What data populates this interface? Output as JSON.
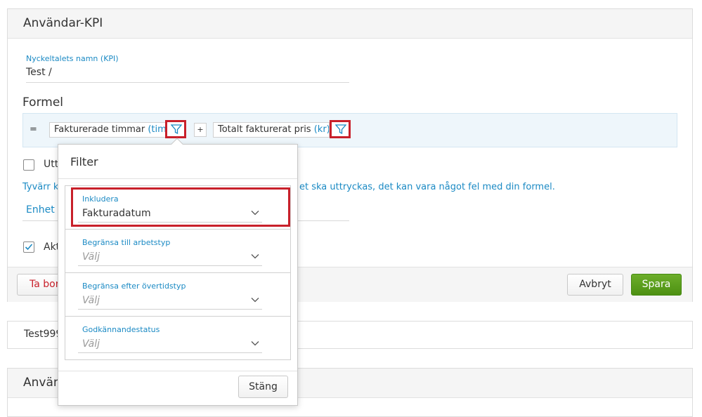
{
  "kpi_card": {
    "title": "Användar-KPI",
    "name_field": {
      "label": "Nyckeltalets namn (KPI)",
      "value": "Test /"
    },
    "formula": {
      "heading": "Formel",
      "equals": "=",
      "term1": {
        "name": "Fakturerade timmar",
        "unit": "(tim"
      },
      "operator": "+",
      "term2": {
        "name": "Totalt fakturerat pris",
        "unit": "(kr)"
      }
    },
    "checkbox1_label": "Utt",
    "error_left": "Tyvärr k",
    "error_right": "et ska uttryckas, det kan vara något fel med din formel.",
    "unit_label": "Enhet",
    "active_checkbox_label": "Akt",
    "delete_button": "Ta bor",
    "cancel_button": "Avbryt",
    "save_button": "Spara"
  },
  "list_item": {
    "text": "Test999"
  },
  "second_card": {
    "title": "Använ"
  },
  "filter_popup": {
    "title": "Filter",
    "sections": [
      {
        "label": "Inkludera",
        "value": "Fakturadatum",
        "is_placeholder": false
      },
      {
        "label": "Begränsa till arbetstyp",
        "value": "Välj",
        "is_placeholder": true
      },
      {
        "label": "Begränsa efter övertidstyp",
        "value": "Välj",
        "is_placeholder": true
      },
      {
        "label": "Godkännandestatus",
        "value": "Välj",
        "is_placeholder": true
      }
    ],
    "close_button": "Stäng"
  },
  "colors": {
    "accent": "#1b8ac4",
    "highlight": "#c8202a",
    "save": "#5a9e1c",
    "danger": "#c8202a"
  }
}
